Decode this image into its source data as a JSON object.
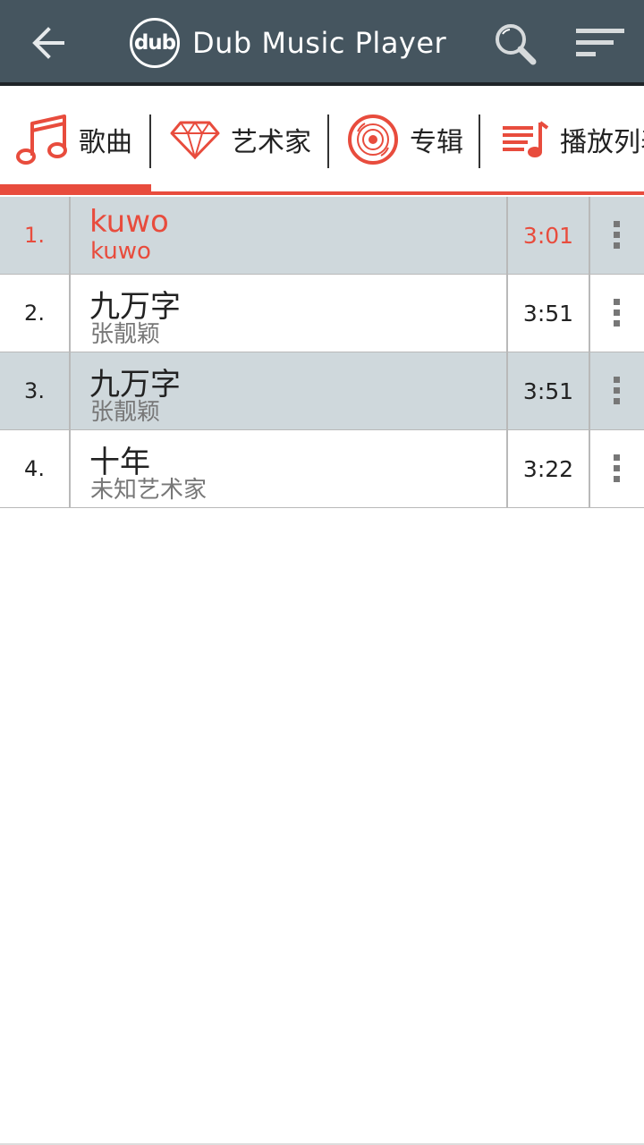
{
  "appbar": {
    "logo_text": "dub",
    "title": "Dub Music Player",
    "back_icon": "arrow-left-icon",
    "search_icon": "search-icon",
    "sort_icon": "sort-icon",
    "background_color": "#45555f"
  },
  "tabs": [
    {
      "label": "歌曲",
      "icon": "music-note-icon",
      "selected": true
    },
    {
      "label": "艺术家",
      "icon": "diamond-icon",
      "selected": false
    },
    {
      "label": "专辑",
      "icon": "disc-icon",
      "selected": false
    },
    {
      "label": "播放列表",
      "icon": "playlist-icon",
      "selected": false
    }
  ],
  "accent_color": "#e84c3d",
  "songs": [
    {
      "index": "1.",
      "title": "kuwo",
      "artist": "kuwo",
      "duration": "3:01",
      "playing": true
    },
    {
      "index": "2.",
      "title": "九万字",
      "artist": "张靓颖",
      "duration": "3:51",
      "playing": false
    },
    {
      "index": "3.",
      "title": "九万字",
      "artist": "张靓颖",
      "duration": "3:51",
      "playing": false
    },
    {
      "index": "4.",
      "title": "十年",
      "artist": "未知艺术家",
      "duration": "3:22",
      "playing": false
    }
  ]
}
